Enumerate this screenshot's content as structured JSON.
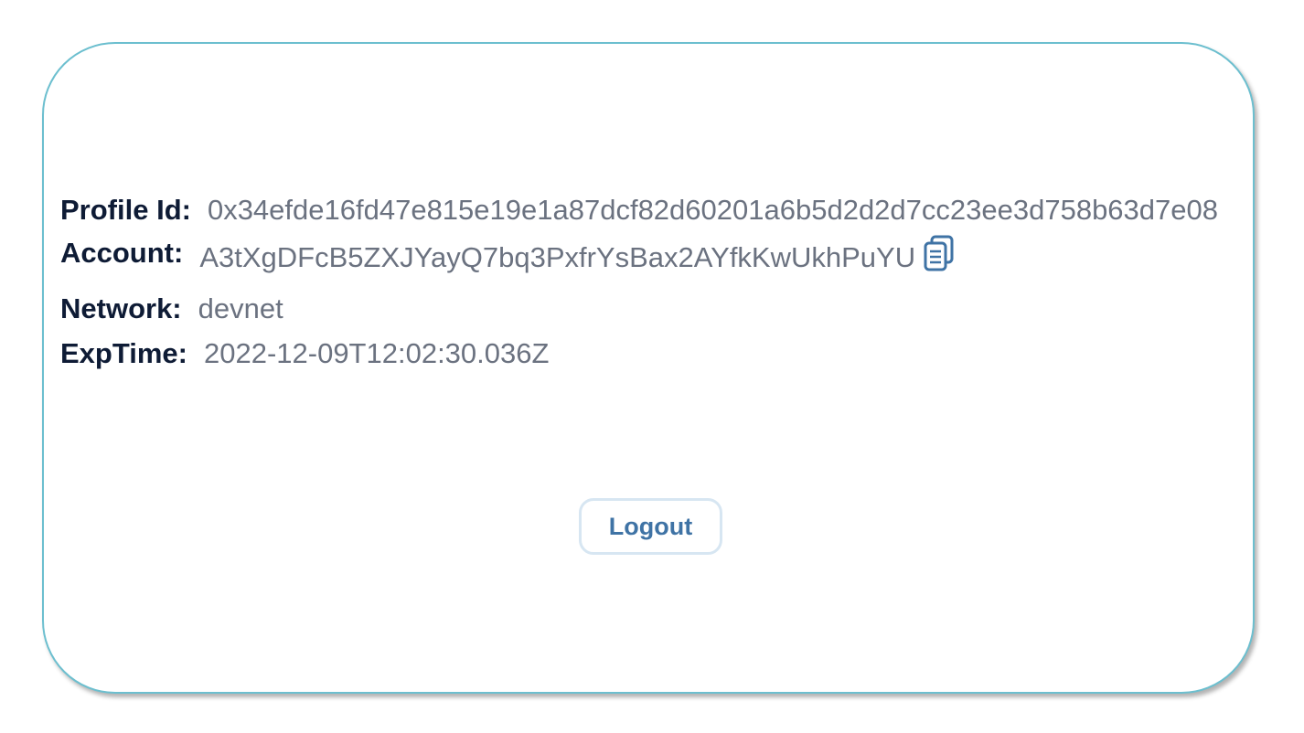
{
  "profile": {
    "profile_id_label": "Profile Id:",
    "profile_id_value": "0x34efde16fd47e815e19e1a87dcf82d60201a6b5d2d2d7cc23ee3d758b63d7e08",
    "account_label": "Account:",
    "account_value": "A3tXgDFcB5ZXJYayQ7bq3PxfrYsBax2AYfkKwUkhPuYU",
    "network_label": "Network:",
    "network_value": "devnet",
    "exptime_label": "ExpTime:",
    "exptime_value": "2022-12-09T12:02:30.036Z"
  },
  "actions": {
    "logout_label": "Logout",
    "copy_icon": "copy-icon"
  },
  "colors": {
    "card_border": "#6cbfcf",
    "label_text": "#0e1b35",
    "value_text": "#6b7280",
    "accent": "#3f73a5"
  }
}
